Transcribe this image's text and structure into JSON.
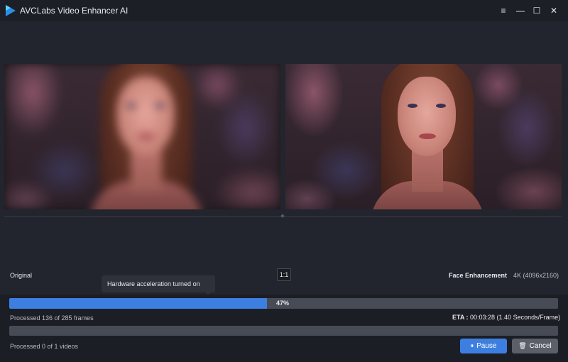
{
  "app": {
    "title": "AVCLabs Video Enhancer AI",
    "accent_color": "#3d7fe0"
  },
  "window_controls": {
    "menu_icon": "≡",
    "minimize_icon": "—",
    "maximize_icon": "☐",
    "close_icon": "✕"
  },
  "preview": {
    "original_label": "Original",
    "ratio_button_label": "1:1",
    "enhancement_label": "Face Enhancement",
    "resolution_label": "4K (4096x2160)"
  },
  "tooltip": {
    "text": "Hardware acceleration turned on"
  },
  "progress": {
    "percent_value": 0.47,
    "percent_label": "47%",
    "frames_text": "Processed 136 of 285 frames",
    "eta_label": "ETA :",
    "eta_value": "00:03:28 (1.40 Seconds/Frame)",
    "videos_text": "Processed 0 of 1 videos"
  },
  "buttons": {
    "pause_icon": "⏸",
    "pause_label": "Pause",
    "cancel_icon": "🗑",
    "cancel_label": "Cancel"
  }
}
